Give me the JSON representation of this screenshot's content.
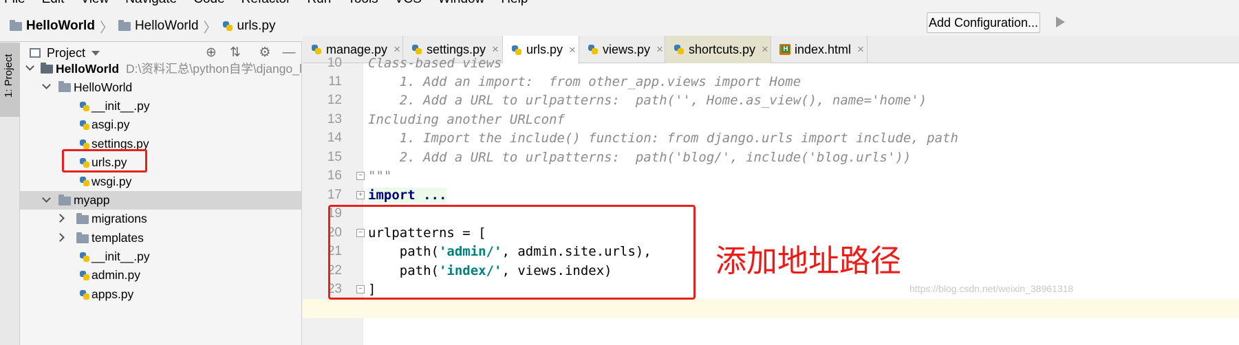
{
  "menu": [
    "File",
    "Edit",
    "View",
    "Navigate",
    "Code",
    "Refactor",
    "Run",
    "Tools",
    "VCS",
    "Window",
    "Help"
  ],
  "breadcrumb": {
    "project": "HelloWorld",
    "folder": "HelloWorld",
    "file": "urls.py"
  },
  "toolbar": {
    "add_config_label": "Add Configuration..."
  },
  "toolstrip": {
    "project_tab": "1: Project"
  },
  "project_panel": {
    "title": "Project",
    "root_name": "HelloWorld",
    "root_path": "D:\\资料汇总\\python自学\\django_lea",
    "tree": [
      {
        "label": "HelloWorld"
      },
      {
        "label": "__init__.py"
      },
      {
        "label": "asgi.py"
      },
      {
        "label": "settings.py"
      },
      {
        "label": "urls.py"
      },
      {
        "label": "wsgi.py"
      },
      {
        "label": "myapp"
      },
      {
        "label": "migrations"
      },
      {
        "label": "templates"
      },
      {
        "label": "__init__.py"
      },
      {
        "label": "admin.py"
      },
      {
        "label": "apps.py"
      }
    ]
  },
  "tabs": [
    {
      "label": "manage.py",
      "close": "×"
    },
    {
      "label": "settings.py",
      "close": "×"
    },
    {
      "label": "urls.py",
      "close": "×"
    },
    {
      "label": "views.py",
      "close": "×"
    },
    {
      "label": "shortcuts.py",
      "close": "×"
    },
    {
      "label": "index.html",
      "close": "×"
    }
  ],
  "code": {
    "lines": [
      {
        "n": "10",
        "text": "Class-based views"
      },
      {
        "n": "11",
        "text": "    1. Add an import:  from other_app.views import Home"
      },
      {
        "n": "12",
        "text": "    2. Add a URL to urlpatterns:  path('', Home.as_view(), name='home')"
      },
      {
        "n": "13",
        "text": "Including another URLconf"
      },
      {
        "n": "14",
        "text": "    1. Import the include() function: from django.urls import include, path"
      },
      {
        "n": "15",
        "text": "    2. Add a URL to urlpatterns:  path('blog/', include('blog.urls'))"
      },
      {
        "n": "16",
        "text": "\"\"\""
      },
      {
        "n": "17",
        "text": "import ..."
      },
      {
        "n": "19",
        "text": ""
      },
      {
        "n": "20",
        "text": "urlpatterns = ["
      },
      {
        "n": "21",
        "pre": "    path(",
        "str": "'admin/'",
        "post": ", admin.site.urls),"
      },
      {
        "n": "22",
        "pre": "    path(",
        "str": "'index/'",
        "post": ", views.index)"
      },
      {
        "n": "23",
        "text": "]"
      }
    ]
  },
  "annotation": "添加地址路径",
  "watermark": "https://blog.csdn.net/weixin_38961318",
  "colors": {
    "highlight_red": "#e8201b",
    "keyword_navy": "#000080",
    "string_teal": "#008080",
    "docstring_gray": "#8c8c8c"
  }
}
